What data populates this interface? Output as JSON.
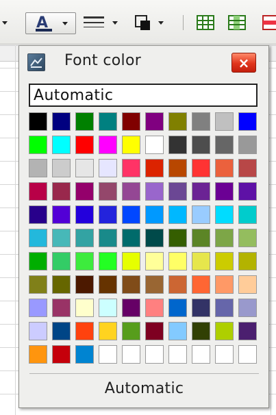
{
  "popup": {
    "title": "Font color",
    "close_label": "×",
    "name_field_value": "Automatic",
    "footer_label": "Automatic"
  },
  "palette": [
    [
      "#000000",
      "#000080",
      "#008000",
      "#008080",
      "#800000",
      "#800080",
      "#808000",
      "#808080",
      "#c0c0c0",
      "#0000ff"
    ],
    [
      "#00ff00",
      "#00ffff",
      "#ff0000",
      "#ff00ff",
      "#ffff00",
      "#ffffff",
      "#333333",
      "#4d4d4d",
      "#666666",
      "#999999"
    ],
    [
      "#b3b3b3",
      "#cccccc",
      "#e6e6e6",
      "#e6e6ff",
      "#ff3366",
      "#dc2300",
      "#b84700",
      "#ff3333",
      "#eb613d",
      "#b84747"
    ],
    [
      "#b80047",
      "#99284c",
      "#94006b",
      "#94476b",
      "#944794",
      "#9966cc",
      "#6b4794",
      "#6b2394",
      "#6b0094",
      "#5e11a6"
    ],
    [
      "#28008b",
      "#5200d6",
      "#2300dc",
      "#2323dc",
      "#0047ff",
      "#0099ff",
      "#00b8ff",
      "#99ccff",
      "#00dcff",
      "#00cccc"
    ],
    [
      "#23b8dc",
      "#47b8b8",
      "#33a3a3",
      "#198a8a",
      "#006b6b",
      "#004a4a",
      "#355e00",
      "#5c8526",
      "#7da647",
      "#94bd5e"
    ],
    [
      "#00ae00",
      "#33cc66",
      "#3deb3d",
      "#23ff23",
      "#e6ff00",
      "#ffff99",
      "#ffff66",
      "#e6e64c",
      "#cccc00",
      "#b3b300"
    ],
    [
      "#808019",
      "#666600",
      "#4c1900",
      "#663300",
      "#804c19",
      "#996633",
      "#cc6633",
      "#ff6633",
      "#ff9966",
      "#ffcc99"
    ],
    [
      "#9999ff",
      "#993366",
      "#ffffcc",
      "#ccffff",
      "#660066",
      "#ff8080",
      "#0066cc",
      "#333366",
      "#6666aa",
      "#9999cc"
    ],
    [
      "#ccccff",
      "#004586",
      "#ff420e",
      "#ffd320",
      "#579d1c",
      "#7e0021",
      "#83caff",
      "#314004",
      "#aecf00",
      "#4b1f6f"
    ],
    [
      "#ff950e",
      "#c5000b",
      "#0084d1",
      "#ffffff",
      "#ffffff",
      "#ffffff",
      "#ffffff",
      "#ffffff",
      "#ffffff",
      "#ffffff"
    ]
  ],
  "toolbar": {
    "font_color_icon": "font-color-icon",
    "line_style_icon": "line-style-icon",
    "border_color_icon": "border-color-icon",
    "insert_rows_icon": "insert-rows-icon",
    "insert_columns_icon": "insert-columns-icon",
    "delete_rows_icon": "delete-rows-icon"
  }
}
